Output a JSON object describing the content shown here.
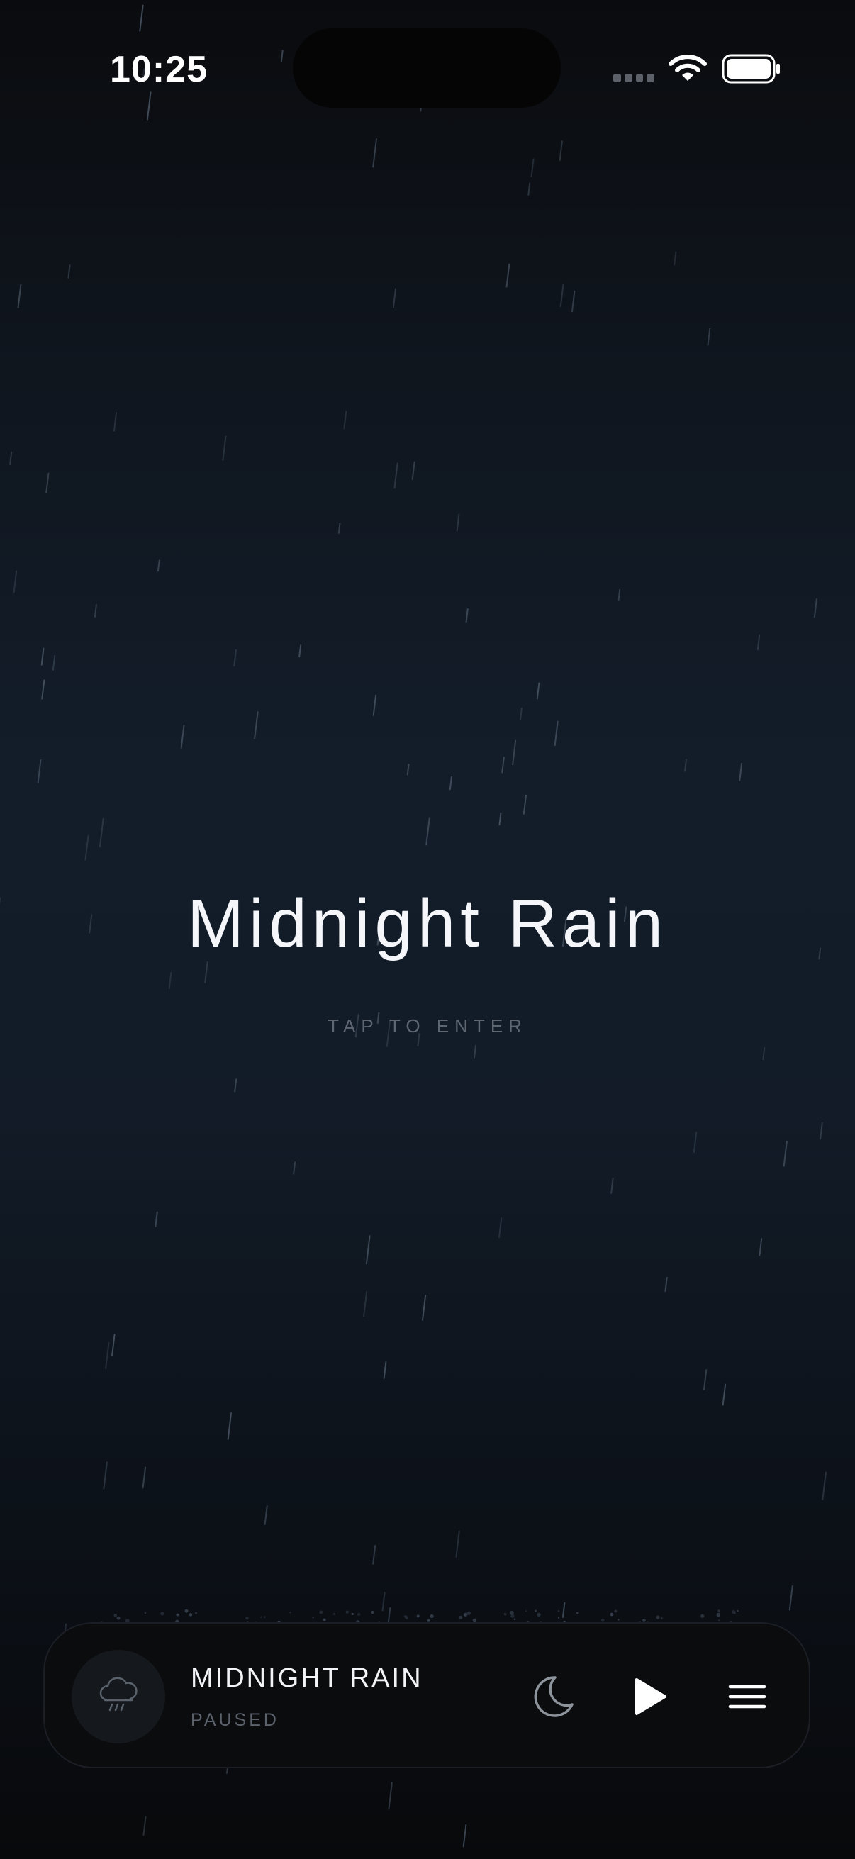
{
  "status_bar": {
    "time": "10:25",
    "icons": [
      "cellular-signal-icon",
      "wifi-icon",
      "battery-icon"
    ]
  },
  "screen": {
    "title": "Midnight Rain",
    "subtitle": "TAP TO ENTER"
  },
  "player": {
    "track_name": "MIDNIGHT RAIN",
    "state": "PAUSED",
    "icons": {
      "artwork": "rain-cloud-icon",
      "sleep": "moon-icon",
      "play": "play-icon",
      "menu": "menu-icon"
    }
  },
  "colors": {
    "background_top": "#0a0b0e",
    "background_mid": "#131d2a",
    "background_bottom": "#08090b",
    "title_text": "#f4f6f9",
    "muted_text": "#5e6672",
    "player_bg": "#0b0c0e"
  }
}
